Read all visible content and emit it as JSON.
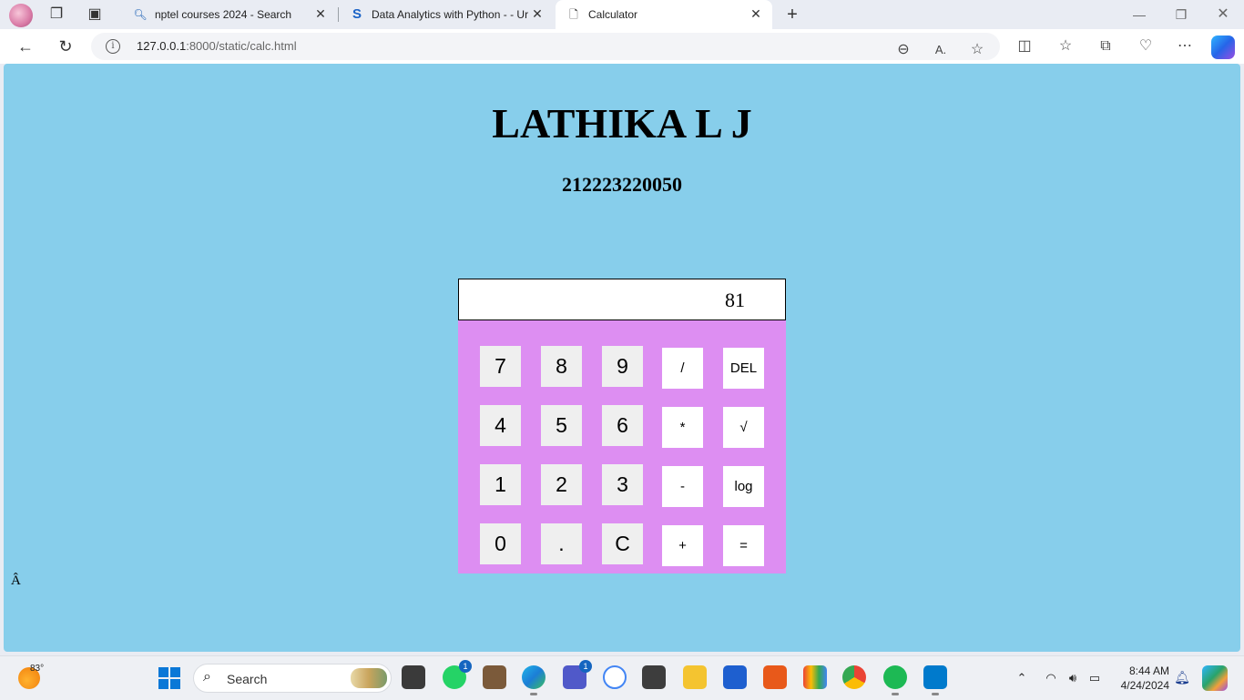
{
  "browser": {
    "tabs": [
      {
        "title": "nptel courses 2024 - Search",
        "icon": "search-icon",
        "active": false
      },
      {
        "title": "Data Analytics with Python - - Ur",
        "icon": "s-logo-icon",
        "active": false
      },
      {
        "title": "Calculator",
        "icon": "page-icon",
        "active": true
      }
    ],
    "url": {
      "host": "127.0.0.1",
      "rest": ":8000/static/calc.html"
    }
  },
  "page": {
    "name": "LATHIKA L J",
    "id": "212223220050",
    "stray_char": "Â"
  },
  "calculator": {
    "display_value": "81",
    "keys": [
      {
        "label": "7",
        "kind": "digit"
      },
      {
        "label": "8",
        "kind": "digit"
      },
      {
        "label": "9",
        "kind": "digit"
      },
      {
        "label": "/",
        "kind": "op"
      },
      {
        "label": "DEL",
        "kind": "op"
      },
      {
        "label": "4",
        "kind": "digit"
      },
      {
        "label": "5",
        "kind": "digit"
      },
      {
        "label": "6",
        "kind": "digit"
      },
      {
        "label": "*",
        "kind": "op"
      },
      {
        "label": "√",
        "kind": "op"
      },
      {
        "label": "1",
        "kind": "digit"
      },
      {
        "label": "2",
        "kind": "digit"
      },
      {
        "label": "3",
        "kind": "digit"
      },
      {
        "label": "-",
        "kind": "op"
      },
      {
        "label": "log",
        "kind": "op"
      },
      {
        "label": "0",
        "kind": "digit"
      },
      {
        "label": ".",
        "kind": "digit"
      },
      {
        "label": "C",
        "kind": "digit"
      },
      {
        "label": "+",
        "kind": "op"
      },
      {
        "label": "=",
        "kind": "op"
      }
    ],
    "colors": {
      "page_bg": "#87ceeb",
      "keypad_bg": "#dd8ef2",
      "digit_key": "#efefef",
      "op_key": "#ffffff"
    }
  },
  "taskbar": {
    "weather_temp": "83°",
    "search_label": "Search",
    "whatsapp_badge": "1",
    "teams_badge": "1",
    "time": "8:44 AM",
    "date": "4/24/2024"
  }
}
